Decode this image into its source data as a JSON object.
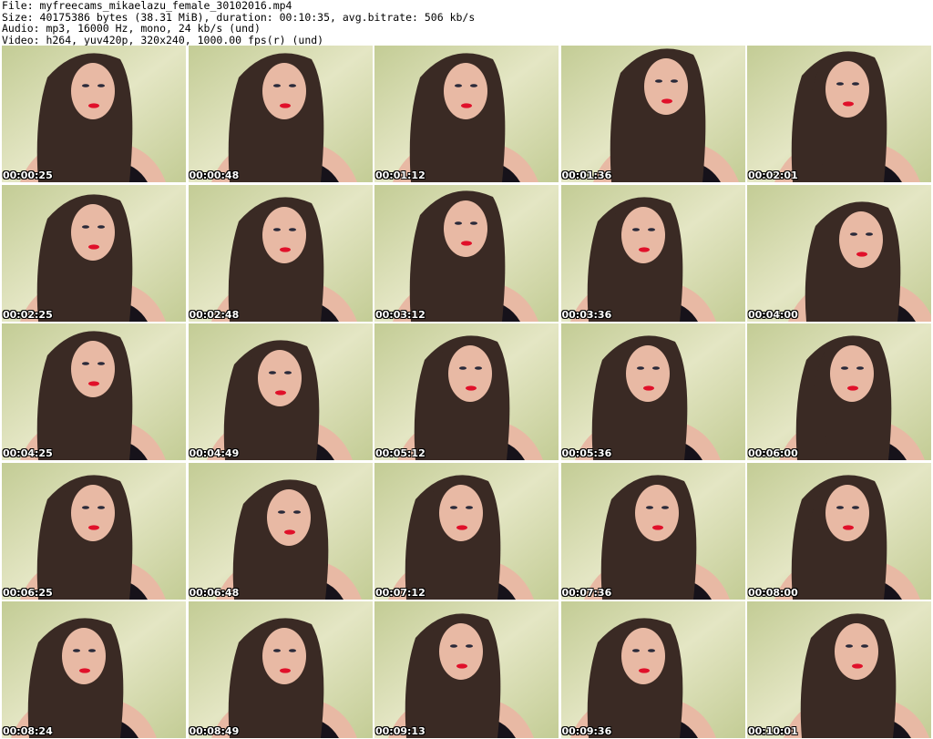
{
  "header": {
    "file_line": "File: myfreecams_mikaelazu_female_30102016.mp4",
    "size_line": "Size: 40175386 bytes (38.31 MiB), duration: 00:10:35, avg.bitrate: 506 kb/s",
    "audio_line": "Audio: mp3, 16000 Hz, mono, 24 kb/s (und)",
    "video_line": "Video: h264, yuv420p, 320x240, 1000.00 fps(r) (und)"
  },
  "thumbnails": [
    {
      "timestamp": "00:00:25"
    },
    {
      "timestamp": "00:00:48"
    },
    {
      "timestamp": "00:01:12"
    },
    {
      "timestamp": "00:01:36"
    },
    {
      "timestamp": "00:02:01"
    },
    {
      "timestamp": "00:02:25"
    },
    {
      "timestamp": "00:02:48"
    },
    {
      "timestamp": "00:03:12"
    },
    {
      "timestamp": "00:03:36"
    },
    {
      "timestamp": "00:04:00"
    },
    {
      "timestamp": "00:04:25"
    },
    {
      "timestamp": "00:04:49"
    },
    {
      "timestamp": "00:05:12"
    },
    {
      "timestamp": "00:05:36"
    },
    {
      "timestamp": "00:06:00"
    },
    {
      "timestamp": "00:06:25"
    },
    {
      "timestamp": "00:06:48"
    },
    {
      "timestamp": "00:07:12"
    },
    {
      "timestamp": "00:07:36"
    },
    {
      "timestamp": "00:08:00"
    },
    {
      "timestamp": "00:08:24"
    },
    {
      "timestamp": "00:08:49"
    },
    {
      "timestamp": "00:09:13"
    },
    {
      "timestamp": "00:09:36"
    },
    {
      "timestamp": "00:10:01"
    }
  ],
  "colors": {
    "wall": "#c3cc95",
    "wall_light": "#e4e6c4",
    "hair": "#3a2a24",
    "skin": "#e8b9a4",
    "top": "#16121a",
    "lips": "#e0102a"
  }
}
